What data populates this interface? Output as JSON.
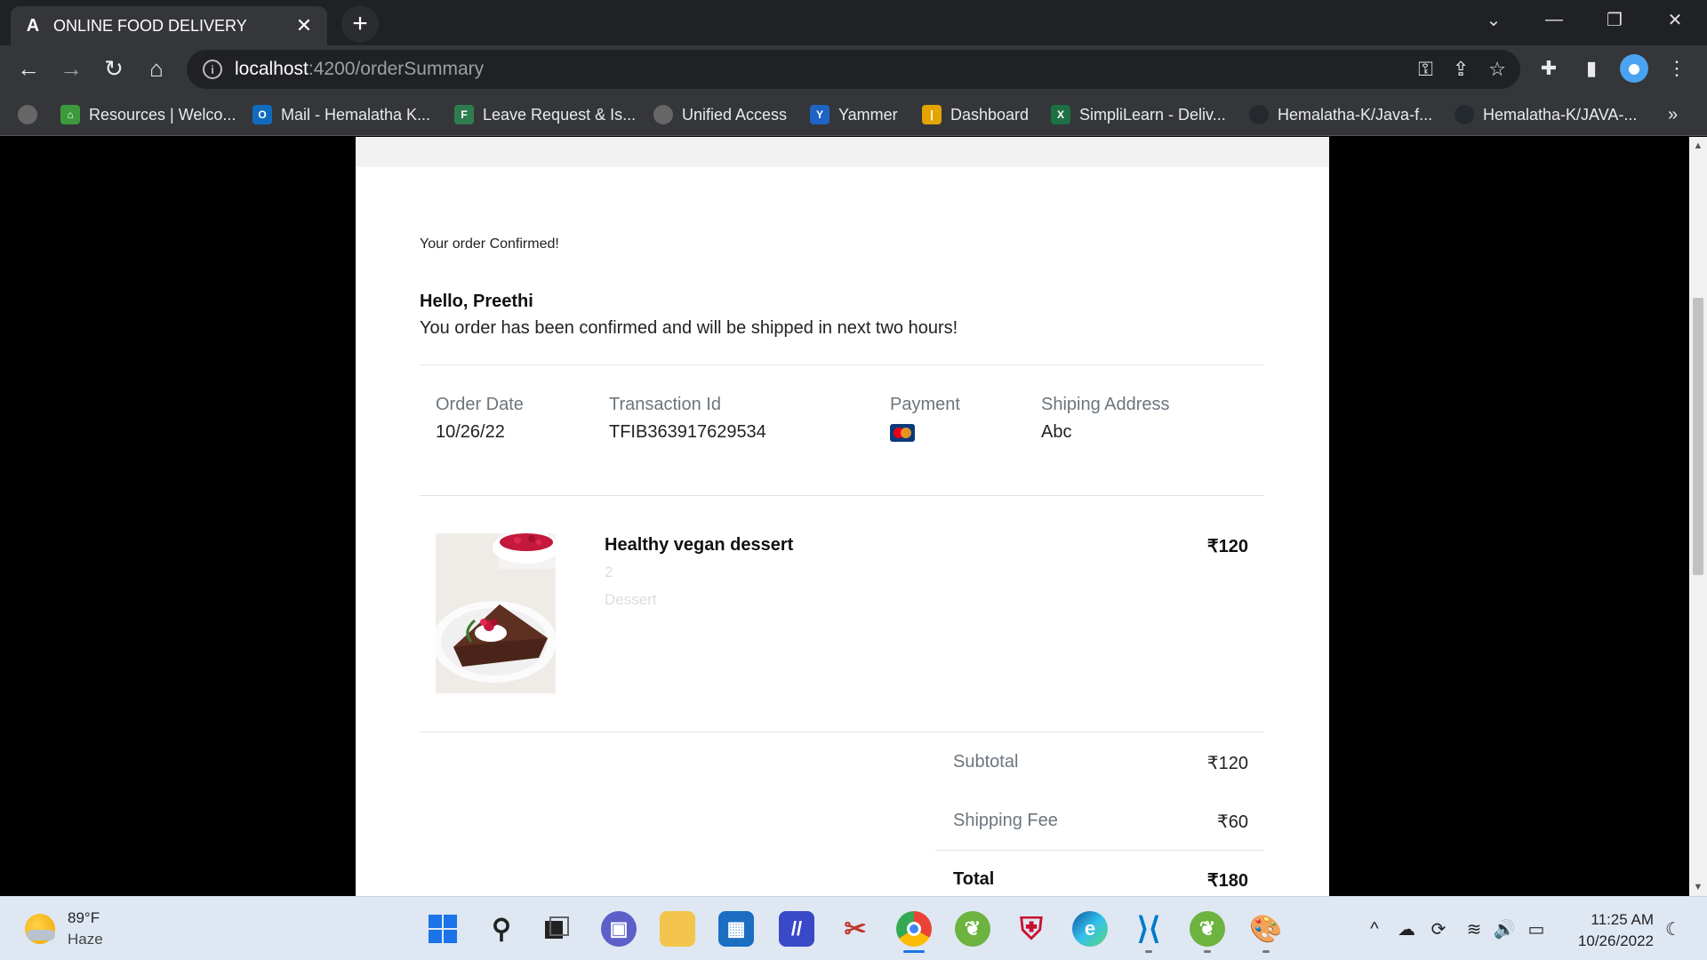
{
  "browser": {
    "tab_title": "ONLINE FOOD DELIVERY",
    "tab_favicon": "A",
    "url_host": "localhost",
    "url_path": ":4200/orderSummary",
    "bookmarks": [
      {
        "label": "Resources | Welco...",
        "icon": "resources-icon",
        "color": "#3c9a3c"
      },
      {
        "label": "Mail - Hemalatha K...",
        "icon": "outlook-icon",
        "color": "#0f6cbd"
      },
      {
        "label": "Leave Request & Is...",
        "icon": "forms-icon",
        "color": "#2f7d4f"
      },
      {
        "label": "Unified Access",
        "icon": "globe-icon",
        "color": "#666666"
      },
      {
        "label": "Yammer",
        "icon": "yammer-icon",
        "color": "#1f64c4"
      },
      {
        "label": "Dashboard",
        "icon": "dashboard-icon",
        "color": "#e3a400"
      },
      {
        "label": "SimpliLearn - Deliv...",
        "icon": "excel-icon",
        "color": "#1d7044"
      },
      {
        "label": "Hemalatha-K/Java-f...",
        "icon": "github-icon",
        "color": "#24292e"
      },
      {
        "label": "Hemalatha-K/JAVA-...",
        "icon": "github-icon",
        "color": "#24292e"
      }
    ]
  },
  "order": {
    "confirm_note": "Your order Confirmed!",
    "greeting": "Hello, Preethi",
    "message": "You order has been confirmed and will be shipped in next two hours!",
    "info": {
      "order_date_label": "Order Date",
      "order_date": "10/26/22",
      "transaction_label": "Transaction Id",
      "transaction_id": "TFIB363917629534",
      "payment_label": "Payment",
      "payment_icon": "card-icon",
      "address_label": "Shiping Address",
      "address": "Abc"
    },
    "item": {
      "name": "Healthy vegan dessert",
      "quantity": "2",
      "category": "Dessert",
      "price": "₹120"
    },
    "summary": {
      "subtotal_label": "Subtotal",
      "subtotal": "₹120",
      "shipping_label": "Shipping Fee",
      "shipping": "₹60",
      "total_label": "Total",
      "total": "₹180"
    }
  },
  "taskbar": {
    "temperature": "89°F",
    "weather": "Haze",
    "time": "11:25 AM",
    "date": "10/26/2022"
  }
}
